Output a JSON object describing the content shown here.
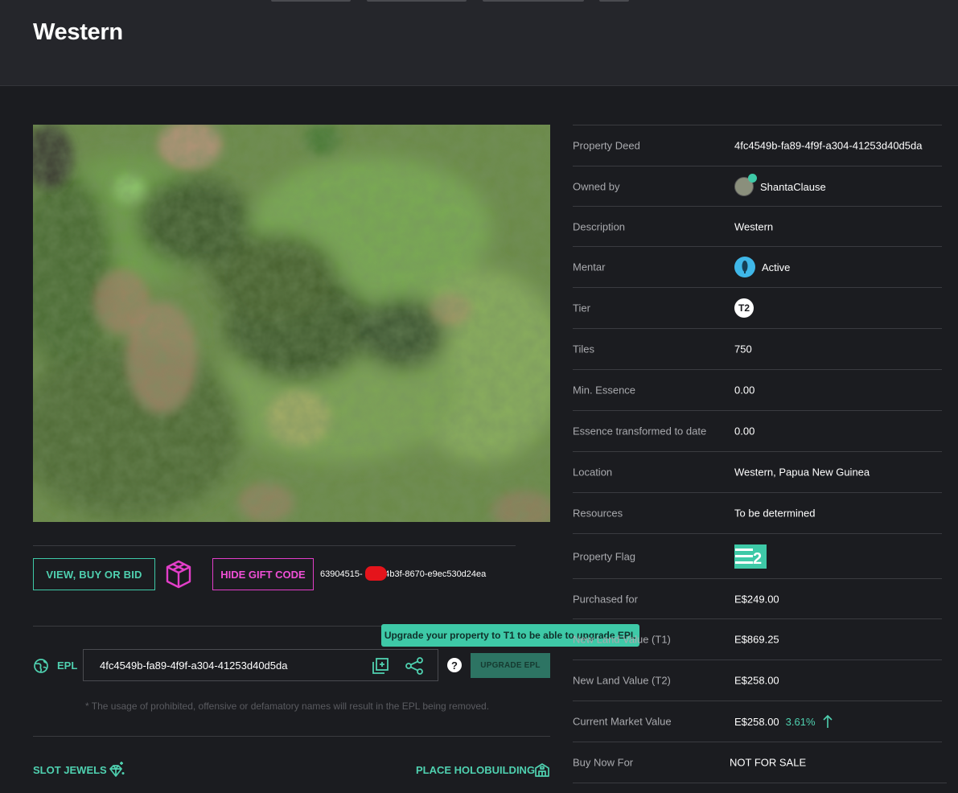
{
  "page": {
    "title": "Western"
  },
  "actions": {
    "view_buy_bid": "VIEW, BUY OR BID",
    "hide_gift_code": "HIDE GIFT CODE",
    "gift_code_visible_prefix": "63904515-",
    "gift_code_visible_suffix": "-4b3f-8670-e9ec530d24ea"
  },
  "epl": {
    "label": "EPL",
    "value": "4fc4549b-fa89-4f9f-a304-41253d40d5da",
    "upgrade_button": "UPGRADE EPL",
    "tooltip": "Upgrade your property to T1 to be able to upgrade EPL",
    "disclaimer": "* The usage of prohibited, offensive or defamatory names will result in the EPL being removed.",
    "help_glyph": "?"
  },
  "footer_actions": {
    "slot_jewels": "SLOT JEWELS",
    "place_holobuilding": "PLACE HOLOBUILDING"
  },
  "properties": [
    {
      "label": "Property Deed",
      "value": "4fc4549b-fa89-4f9f-a304-41253d40d5da"
    },
    {
      "label": "Owned by",
      "value": "ShantaClause",
      "icon": "avatar"
    },
    {
      "label": "Description",
      "value": "Western"
    },
    {
      "label": "Mentar",
      "value": "Active",
      "icon": "mentar-icon"
    },
    {
      "label": "Tier",
      "value": "T2",
      "icon": "tier-badge"
    },
    {
      "label": "Tiles",
      "value": "750"
    },
    {
      "label": "Min. Essence",
      "value": "0.00"
    },
    {
      "label": "Essence transformed to date",
      "value": "0.00"
    },
    {
      "label": "Location",
      "value": "Western, Papua New Guinea"
    },
    {
      "label": "Resources",
      "value": "To be determined"
    },
    {
      "label": "Property Flag",
      "value": "",
      "icon": "flag-icon"
    },
    {
      "label": "Purchased for",
      "value": "E$249.00"
    },
    {
      "label": "New Land Value (T1)",
      "value": "E$869.25"
    },
    {
      "label": "New Land Value (T2)",
      "value": "E$258.00"
    },
    {
      "label": "Current Market Value",
      "value": "E$258.00",
      "change": "3.61%",
      "icon": "arrow-up-icon"
    },
    {
      "label": "Buy Now For",
      "value": "NOT FOR SALE"
    }
  ],
  "colors": {
    "background": "#1b1c20",
    "header": "#25262b",
    "accent_teal": "#3ec9a7",
    "accent_pink": "#e23ec8",
    "mentar_blue": "#3fb7e8"
  }
}
